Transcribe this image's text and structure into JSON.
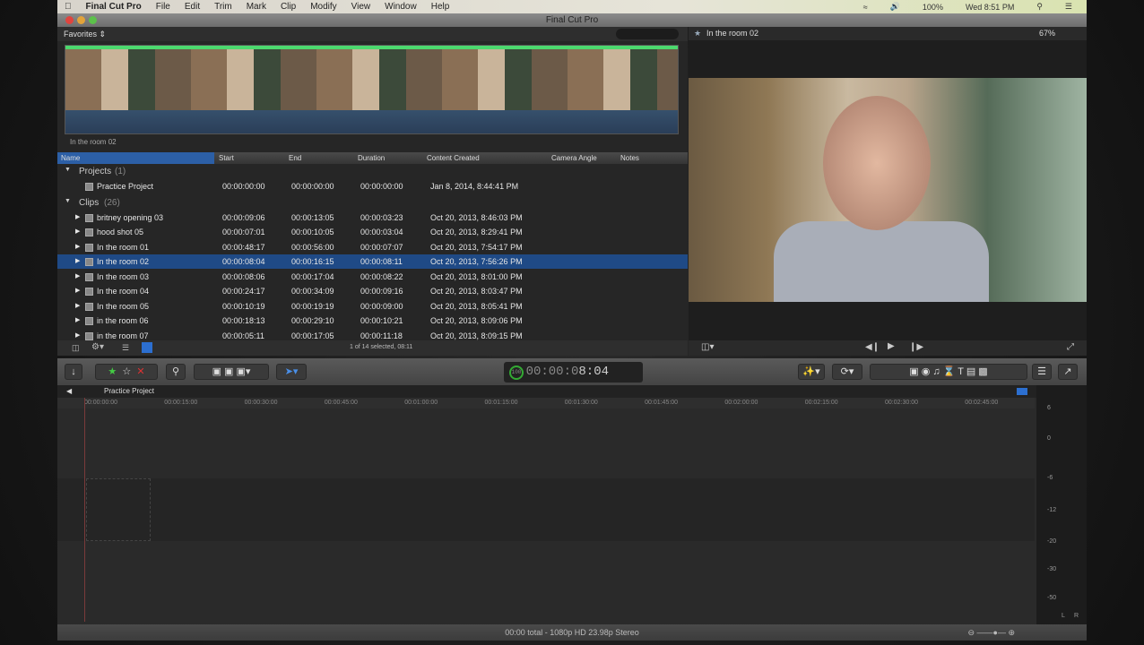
{
  "menubar": {
    "app": "Final Cut Pro",
    "items": [
      "File",
      "Edit",
      "Trim",
      "Mark",
      "Clip",
      "Modify",
      "View",
      "Window",
      "Help"
    ],
    "battery": "100%",
    "clock": "Wed 8:51 PM"
  },
  "window": {
    "title": "Final Cut Pro"
  },
  "browser": {
    "library": "Favorites",
    "filmstrip_label": "In the room 02",
    "columns": [
      "Name",
      "Start",
      "End",
      "Duration",
      "Content Created",
      "Camera Angle",
      "Notes"
    ],
    "projects_group": {
      "label": "Projects",
      "count": "(1)"
    },
    "projects": [
      {
        "name": "Practice Project",
        "start": "00:00:00:00",
        "end": "00:00:00:00",
        "duration": "00:00:00:00",
        "created": "Jan 8, 2014, 8:44:41 PM"
      }
    ],
    "clips_group": {
      "label": "Clips",
      "count": "(26)"
    },
    "clips": [
      {
        "name": "britney opening 03",
        "start": "00:00:09:06",
        "end": "00:00:13:05",
        "duration": "00:00:03:23",
        "created": "Oct 20, 2013, 8:46:03 PM"
      },
      {
        "name": "hood shot 05",
        "start": "00:00:07:01",
        "end": "00:00:10:05",
        "duration": "00:00:03:04",
        "created": "Oct 20, 2013, 8:29:41 PM"
      },
      {
        "name": "In the room 01",
        "start": "00:00:48:17",
        "end": "00:00:56:00",
        "duration": "00:00:07:07",
        "created": "Oct 20, 2013, 7:54:17 PM"
      },
      {
        "name": "In the room 02",
        "start": "00:00:08:04",
        "end": "00:00:16:15",
        "duration": "00:00:08:11",
        "created": "Oct 20, 2013, 7:56:26 PM"
      },
      {
        "name": "In the room 03",
        "start": "00:00:08:06",
        "end": "00:00:17:04",
        "duration": "00:00:08:22",
        "created": "Oct 20, 2013, 8:01:00 PM"
      },
      {
        "name": "In the room 04",
        "start": "00:00:24:17",
        "end": "00:00:34:09",
        "duration": "00:00:09:16",
        "created": "Oct 20, 2013, 8:03:47 PM"
      },
      {
        "name": "In the room 05",
        "start": "00:00:10:19",
        "end": "00:00:19:19",
        "duration": "00:00:09:00",
        "created": "Oct 20, 2013, 8:05:41 PM"
      },
      {
        "name": "in the room 06",
        "start": "00:00:18:13",
        "end": "00:00:29:10",
        "duration": "00:00:10:21",
        "created": "Oct 20, 2013, 8:09:06 PM"
      },
      {
        "name": "in the room 07",
        "start": "00:00:05:11",
        "end": "00:00:17:05",
        "duration": "00:00:11:18",
        "created": "Oct 20, 2013, 8:09:15 PM"
      }
    ],
    "selected_index": 3,
    "status": "1 of 14 selected, 08:11"
  },
  "viewer": {
    "title": "In the room 02",
    "zoom": "67%"
  },
  "toolbar": {
    "timecode_dim": "00:00:0",
    "timecode": "8:04",
    "speed": "100"
  },
  "timeline": {
    "project": "Practice Project",
    "ruler": [
      "00:00:00:00",
      "00:00:15:00",
      "00:00:30:00",
      "00:00:45:00",
      "00:01:00:00",
      "00:01:15:00",
      "00:01:30:00",
      "00:01:45:00",
      "00:02:00:00",
      "00:02:15:00",
      "00:02:30:00",
      "00:02:45:00"
    ],
    "meter_scale": [
      "6",
      "0",
      "-6",
      "-12",
      "-20",
      "-30",
      "-50"
    ],
    "meter_channels": [
      "L",
      "R"
    ]
  },
  "bottom": {
    "status": "00:00 total - 1080p HD 23.98p Stereo"
  }
}
